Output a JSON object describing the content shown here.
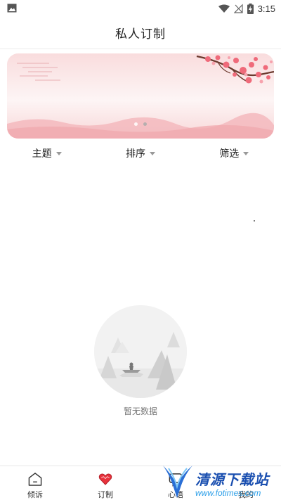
{
  "status_bar": {
    "time": "3:15",
    "icons": [
      "image-icon",
      "wifi-icon",
      "no-signal-icon",
      "battery-charging-icon"
    ]
  },
  "header": {
    "title": "私人订制"
  },
  "banner": {
    "slide_count": 2,
    "active_slide": 1
  },
  "filters": [
    {
      "label": "主题"
    },
    {
      "label": "排序"
    },
    {
      "label": "筛选"
    }
  ],
  "empty_state": {
    "text": "暂无数据"
  },
  "bottom_nav": [
    {
      "label": "倾诉",
      "icon": "home-icon"
    },
    {
      "label": "订制",
      "icon": "heart-icon"
    },
    {
      "label": "心语",
      "icon": "chat-icon"
    },
    {
      "label": "我的",
      "icon": "profile-icon"
    }
  ],
  "watermark": {
    "title": "清源下载站",
    "url": "www.fotimes.com"
  },
  "colors": {
    "accent_red": "#e8323c",
    "banner_pink": "#f7c9cc",
    "blossom": "#ef6a7a"
  }
}
